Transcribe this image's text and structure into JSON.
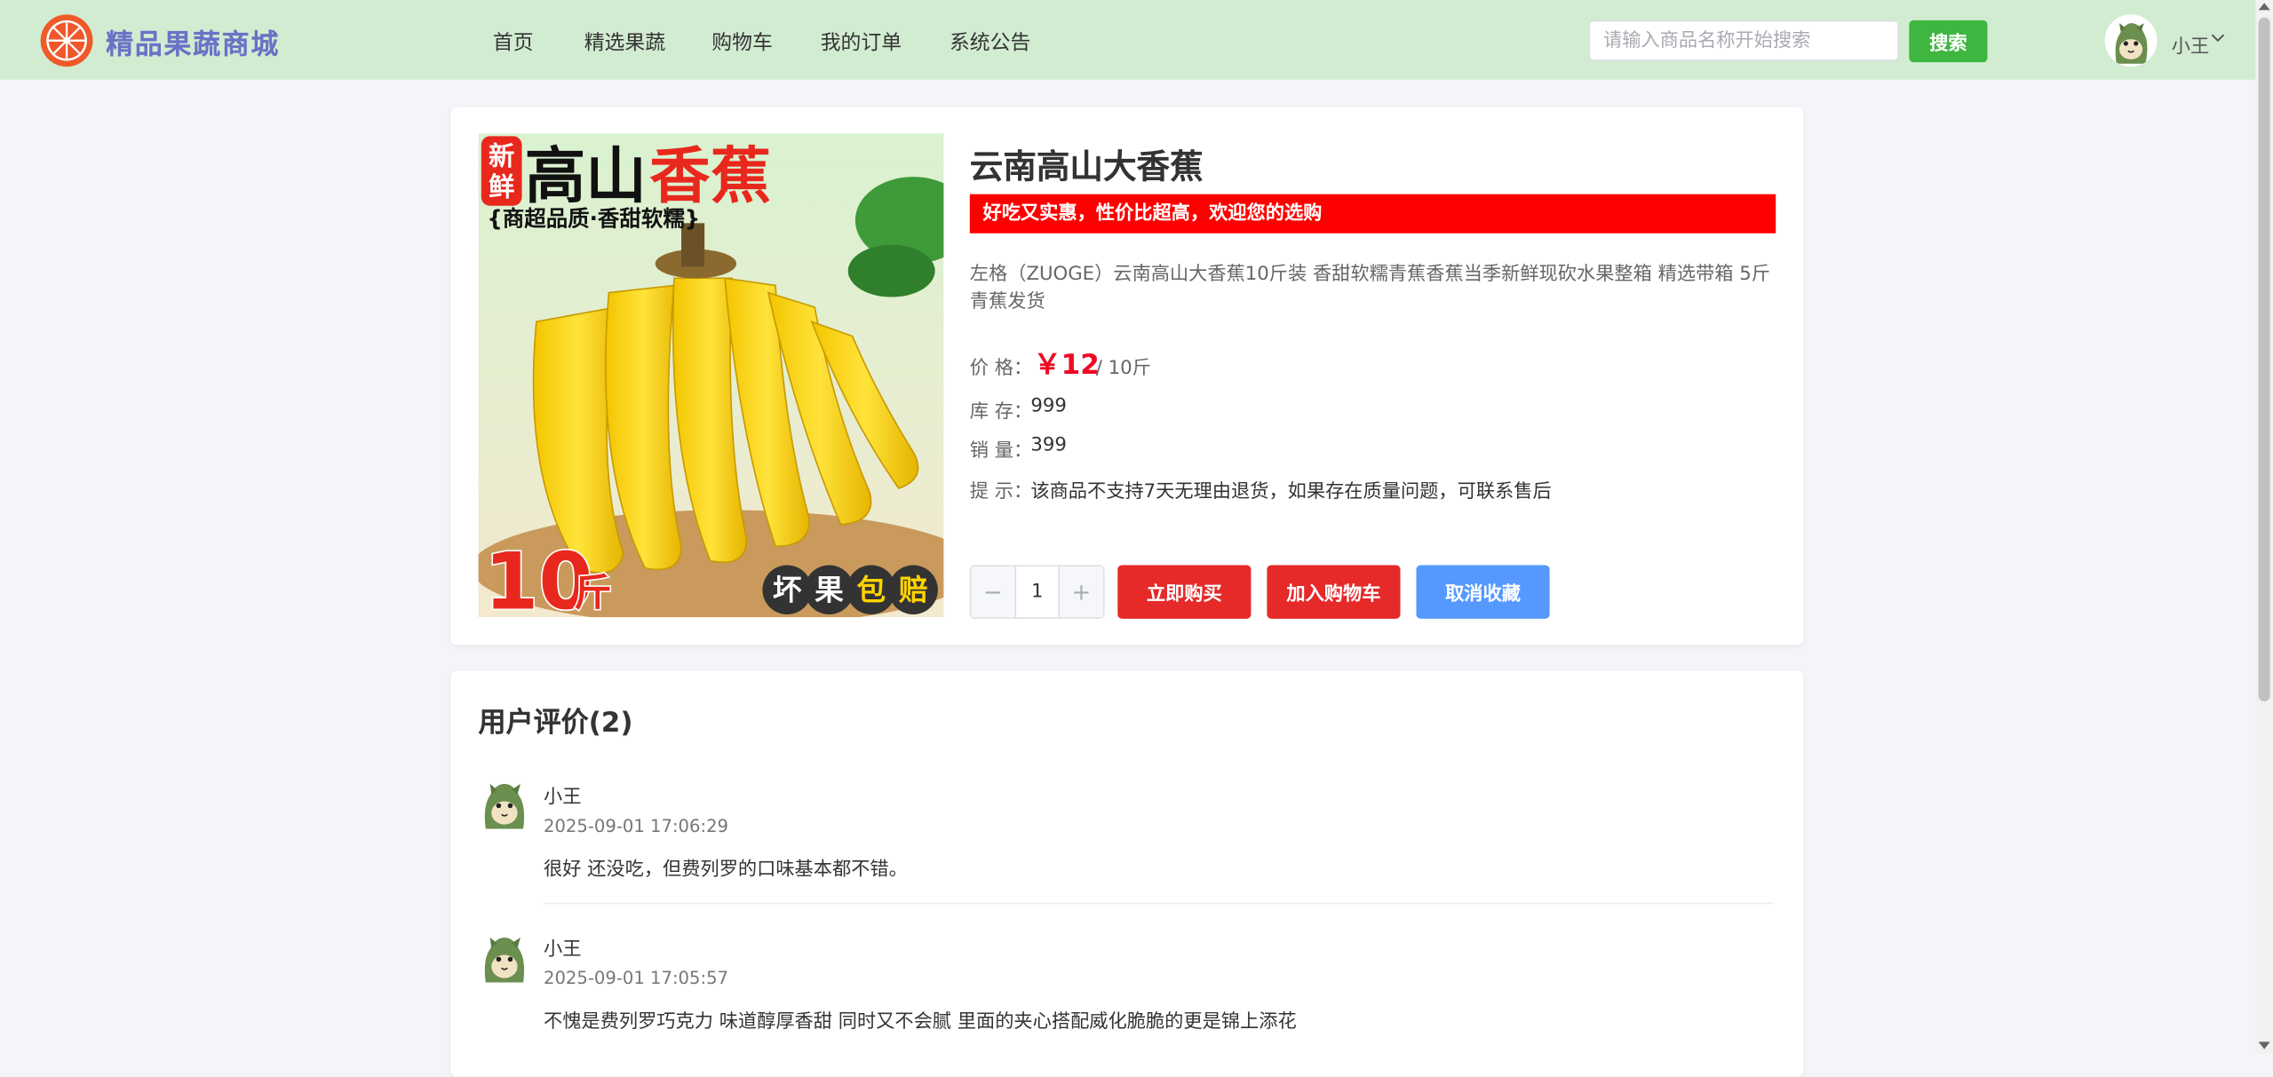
{
  "header": {
    "brand": "精品果蔬商城",
    "nav": [
      "首页",
      "精选果蔬",
      "购物车",
      "我的订单",
      "系统公告"
    ],
    "search_placeholder": "请输入商品名称开始搜索",
    "search_button": "搜索",
    "user_name": "小王",
    "user_menu_icon": "chevron-down-icon"
  },
  "product": {
    "image_text": {
      "badge": "新鲜",
      "headline_part1": "高山",
      "headline_part2": "香蕉",
      "tagline": "{商超品质·香甜软糯}",
      "weight": "10",
      "weight_unit": "斤",
      "guarantee": [
        "坏",
        "果",
        "包",
        "赔"
      ]
    },
    "title": "云南高山大香蕉",
    "slogan": "好吃又实惠，性价比超高，欢迎您的选购",
    "description": "左格（ZUOGE）云南高山大香蕉10斤装 香甜软糯青蕉香蕉当季新鲜现砍水果整箱 精选带箱 5斤 青蕉发货",
    "price_label": "价 格：",
    "price": "￥12",
    "unit": "/ 10斤",
    "stock_label": "库 存：",
    "stock": "999",
    "sales_label": "销 量：",
    "sales": "399",
    "tip_label": "提 示：",
    "tip": "该商品不支持7天无理由退货，如果存在质量问题，可联系售后",
    "quantity": "1",
    "minus": "−",
    "plus": "+",
    "buy_now": "立即购买",
    "add_cart": "加入购物车",
    "unfavorite": "取消收藏"
  },
  "reviews": {
    "title": "用户评价(2)",
    "items": [
      {
        "user": "小王",
        "time": "2025-09-01 17:06:29",
        "text": "很好 还没吃，但费列罗的口味基本都不错。"
      },
      {
        "user": "小王",
        "time": "2025-09-01 17:05:57",
        "text": "不愧是费列罗巧克力 味道醇厚香甜 同时又不会腻 里面的夹心搭配威化脆脆的更是锦上添花"
      }
    ]
  },
  "colors": {
    "header_bg": "#d2ecd2",
    "brand": "#6a72c6",
    "search_btn": "#3fb63f",
    "slogan_bg": "#ff0000",
    "price": "#ee0a24",
    "buy_btn": "#e62929",
    "fav_btn": "#5599ff"
  }
}
